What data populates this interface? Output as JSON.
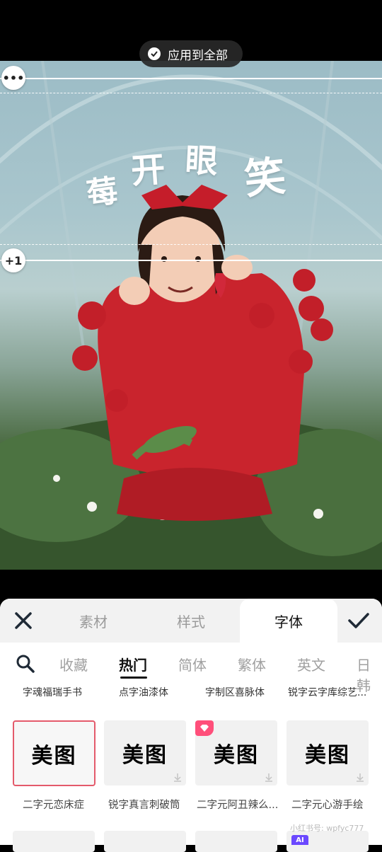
{
  "apply_all_label": "应用到全部",
  "more_handle": "•••",
  "plus_handle": "+1",
  "title_chars": [
    "莓",
    "开",
    "眼",
    "笑"
  ],
  "panel": {
    "tabs": [
      "素材",
      "样式",
      "字体"
    ],
    "active_tab": "字体",
    "categories": [
      "收藏",
      "热门",
      "简体",
      "繁体",
      "英文",
      "日韩"
    ],
    "active_category": "热门",
    "prev_row_names": [
      "字魂福瑞手书",
      "点字油漆体",
      "字制区喜脉体",
      "锐字云字库综艺..."
    ],
    "font_tiles": [
      {
        "preview": "美图",
        "name": "二字元恋床症",
        "selected": true
      },
      {
        "preview": "美图",
        "name": "锐字真言刺破筒",
        "selected": false
      },
      {
        "preview": "美图",
        "name": "二字元阿丑辣么...",
        "selected": false
      },
      {
        "preview": "美图",
        "name": "二字元心游手绘",
        "selected": false
      }
    ],
    "ai_badge": "AI",
    "watermark": "小红书号: wpfyc777"
  },
  "colors": {
    "accent": "#e45a6b",
    "badge": "#ff4f7a"
  }
}
